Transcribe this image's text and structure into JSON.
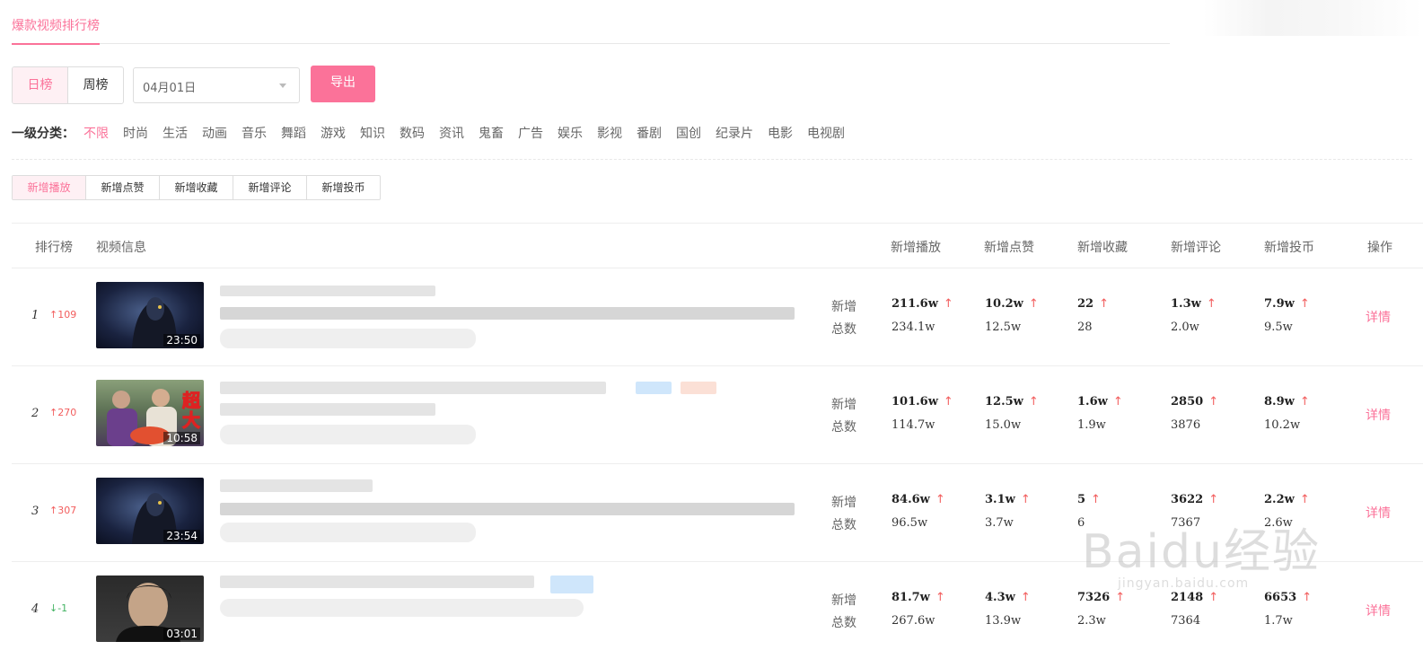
{
  "header": {
    "active_tab": "爆款视频排行榜"
  },
  "controls": {
    "period_options": [
      "日榜",
      "周榜"
    ],
    "date_value": "04月01日",
    "export_label": "导出"
  },
  "categories": {
    "label": "一级分类：",
    "items": [
      "不限",
      "时尚",
      "生活",
      "动画",
      "音乐",
      "舞蹈",
      "游戏",
      "知识",
      "数码",
      "资讯",
      "鬼畜",
      "广告",
      "娱乐",
      "影视",
      "番剧",
      "国创",
      "纪录片",
      "电影",
      "电视剧"
    ],
    "active": "不限"
  },
  "sort_tabs": [
    "新增播放",
    "新增点赞",
    "新增收藏",
    "新增评论",
    "新增投币"
  ],
  "table_headers": {
    "rank": "排行榜",
    "video": "视频信息",
    "play": "新增播放",
    "like": "新增点赞",
    "fav": "新增收藏",
    "comment": "新增评论",
    "coin": "新增投币",
    "op": "操作"
  },
  "row_labels": {
    "new": "新增",
    "total": "总数",
    "detail": "详情"
  },
  "rows": [
    {
      "rank": "1",
      "delta": "↑109",
      "duration": "23:50",
      "play": {
        "new": "211.6w",
        "total": "234.1w"
      },
      "like": {
        "new": "10.2w",
        "total": "12.5w"
      },
      "fav": {
        "new": "22",
        "total": "28"
      },
      "comment": {
        "new": "1.3w",
        "total": "2.0w"
      },
      "coin": {
        "new": "7.9w",
        "total": "9.5w"
      }
    },
    {
      "rank": "2",
      "delta": "↑270",
      "duration": "10:58",
      "thumb_text": "超大",
      "play": {
        "new": "101.6w",
        "total": "114.7w"
      },
      "like": {
        "new": "12.5w",
        "total": "15.0w"
      },
      "fav": {
        "new": "1.6w",
        "total": "1.9w"
      },
      "comment": {
        "new": "2850",
        "total": "3876"
      },
      "coin": {
        "new": "8.9w",
        "total": "10.2w"
      }
    },
    {
      "rank": "3",
      "delta": "↑307",
      "duration": "23:54",
      "play": {
        "new": "84.6w",
        "total": "96.5w"
      },
      "like": {
        "new": "3.1w",
        "total": "3.7w"
      },
      "fav": {
        "new": "5",
        "total": "6"
      },
      "comment": {
        "new": "3622",
        "total": "7367"
      },
      "coin": {
        "new": "2.2w",
        "total": "2.6w"
      }
    },
    {
      "rank": "4",
      "delta": "↓-1",
      "duration": "03:01",
      "play": {
        "new": "81.7w",
        "total": "267.6w"
      },
      "like": {
        "new": "4.3w",
        "total": "13.9w"
      },
      "fav": {
        "new": "7326",
        "total": "2.3w"
      },
      "comment": {
        "new": "2148",
        "total": "7364"
      },
      "coin": {
        "new": "6653",
        "total": "1.7w"
      }
    }
  ],
  "watermark": {
    "brand": "Baidu经验",
    "url": "jingyan.baidu.com"
  },
  "colors": {
    "accent": "#fb7299",
    "up": "#f25d5d",
    "down": "#42b362"
  }
}
